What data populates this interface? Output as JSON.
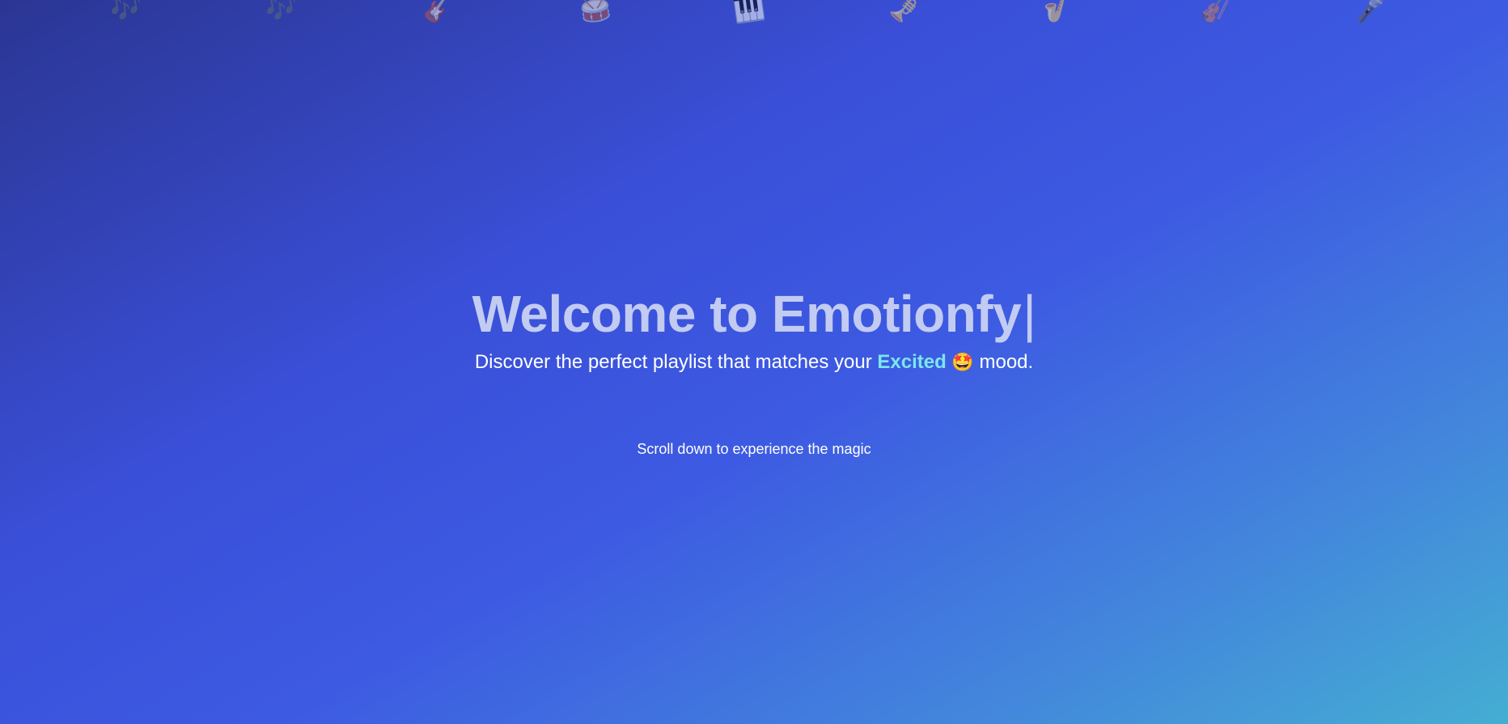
{
  "instrument_icons": [
    {
      "name": "music-notes-icon",
      "glyph": "🎶"
    },
    {
      "name": "music-notes-icon-2",
      "glyph": "🎶"
    },
    {
      "name": "guitar-icon",
      "glyph": "🎸"
    },
    {
      "name": "drum-icon",
      "glyph": "🥁"
    },
    {
      "name": "piano-icon",
      "glyph": "🎹"
    },
    {
      "name": "trumpet-icon",
      "glyph": "🎺"
    },
    {
      "name": "saxophone-icon",
      "glyph": "🎷"
    },
    {
      "name": "violin-icon",
      "glyph": "🎻"
    },
    {
      "name": "microphone-icon",
      "glyph": "🎤"
    }
  ],
  "hero": {
    "title": "Welcome to Emotionfy",
    "cursor": "|",
    "subtitle_before": "Discover the perfect playlist that matches your ",
    "mood": "Excited",
    "mood_emoji": "🤩",
    "subtitle_after": " mood."
  },
  "scroll_hint": "Scroll down to experience the magic",
  "colors": {
    "title": "#c2cbf1",
    "mood_accent": "#7be6ee",
    "background_start": "#2b3693",
    "background_mid": "#3d5ae2",
    "background_end": "#44aed2"
  }
}
